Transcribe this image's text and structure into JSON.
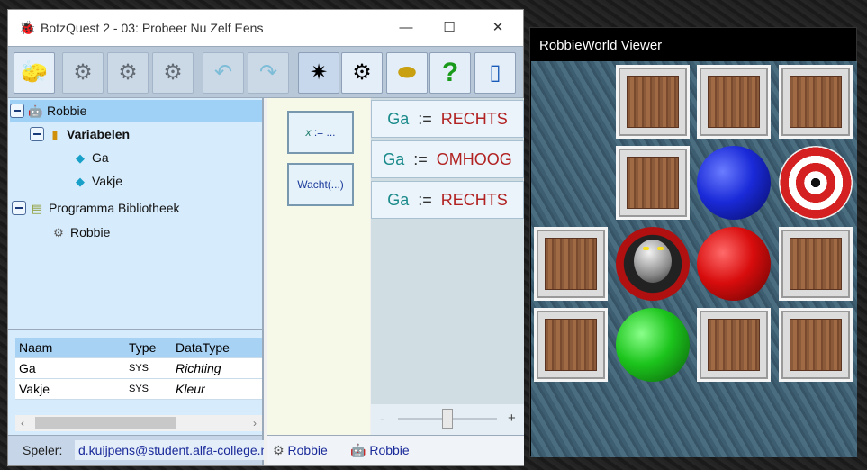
{
  "app": {
    "title": "BotzQuest 2 - 03: Probeer Nu Zelf Eens",
    "window_controls": {
      "minimize": "—",
      "maximize": "☐",
      "close": "✕"
    }
  },
  "toolbar": {
    "buttons": [
      {
        "name": "eraser-button",
        "icon": "eraser-icon",
        "glyph": "🧽",
        "enabled": true
      },
      {
        "name": "add-robot-button",
        "icon": "add-robot-icon",
        "glyph": "⚙",
        "enabled": false
      },
      {
        "name": "add-library-button",
        "icon": "add-library-icon",
        "glyph": "⚙",
        "enabled": false
      },
      {
        "name": "add-gear-button",
        "icon": "add-gear-icon",
        "glyph": "⚙",
        "enabled": false
      },
      {
        "name": "undo-button",
        "icon": "undo-icon",
        "glyph": "↶",
        "enabled": false
      },
      {
        "name": "redo-button",
        "icon": "redo-icon",
        "glyph": "↷",
        "enabled": false
      },
      {
        "name": "run-robot-button",
        "icon": "robot-sparkle-icon",
        "glyph": "✷",
        "enabled": true
      },
      {
        "name": "settings-button",
        "icon": "gears-icon",
        "glyph": "⚙",
        "enabled": true
      },
      {
        "name": "badge-button",
        "icon": "badge-icon",
        "glyph": "⬬",
        "enabled": true
      },
      {
        "name": "help-button",
        "icon": "help-icon",
        "glyph": "?",
        "enabled": true
      },
      {
        "name": "exit-button",
        "icon": "door-icon",
        "glyph": "▯",
        "enabled": true
      }
    ]
  },
  "tree": {
    "robot": "Robbie",
    "variables_folder": "Variabelen",
    "variables": [
      "Ga",
      "Vakje"
    ],
    "library": "Programma Bibliotheek",
    "library_item": "Robbie"
  },
  "var_table": {
    "headers": [
      "Naam",
      "Type",
      "DataType"
    ],
    "rows": [
      [
        "Ga",
        "SYS",
        "Richting"
      ],
      [
        "Vakje",
        "SYS",
        "Kleur"
      ]
    ]
  },
  "status": {
    "speler_label": "Speler:",
    "speler_value": "d.kuijpens@student.alfa-college.nl",
    "items": [
      "Robbie",
      "Robbie"
    ]
  },
  "palette": {
    "blocks": [
      {
        "var": "x",
        "rest": ":= ..."
      },
      {
        "label": "Wacht(...)"
      }
    ]
  },
  "program": {
    "statements": [
      {
        "var": "Ga",
        "op": ":=",
        "value": "RECHTS"
      },
      {
        "var": "Ga",
        "op": ":=",
        "value": "OMHOOG"
      },
      {
        "var": "Ga",
        "op": ":=",
        "value": "RECHTS"
      }
    ],
    "zoom_minus": "-",
    "zoom_plus": "+",
    "zoom_level": 0.5
  },
  "viewer": {
    "title": "RobbieWorld Viewer",
    "grid": [
      [
        "empty",
        "box",
        "box",
        "box"
      ],
      [
        "empty",
        "box",
        "blue-ball",
        "target"
      ],
      [
        "box",
        "robot",
        "red-ball",
        "box"
      ],
      [
        "box",
        "green-ball",
        "box",
        "box"
      ]
    ]
  }
}
